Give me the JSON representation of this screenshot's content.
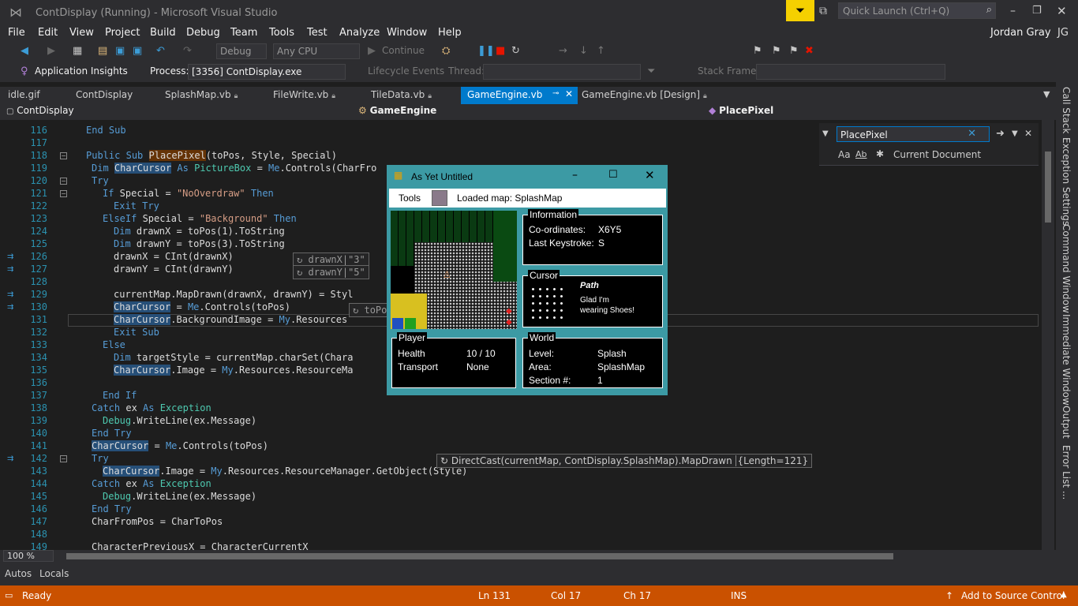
{
  "window": {
    "title": "ContDisplay (Running) - Microsoft Visual Studio",
    "quick_launch_placeholder": "Quick Launch (Ctrl+Q)",
    "user_name": "Jordan Gray",
    "user_initials": "JG"
  },
  "menu": [
    "File",
    "Edit",
    "View",
    "Project",
    "Build",
    "Debug",
    "Team",
    "Tools",
    "Test",
    "Analyze",
    "Window",
    "Help"
  ],
  "toolbar1": {
    "config": "Debug",
    "platform": "Any CPU",
    "continue_label": "Continue"
  },
  "toolbar2": {
    "app_insights": "Application Insights",
    "process_label": "Process:",
    "process_value": "[3356] ContDisplay.exe",
    "lifecycle_label": "Lifecycle Events",
    "thread_label": "Thread:",
    "stack_frame_label": "Stack Frame:"
  },
  "tabs": [
    {
      "label": "idle.gif"
    },
    {
      "label": "ContDisplay"
    },
    {
      "label": "SplashMap.vb"
    },
    {
      "label": "FileWrite.vb"
    },
    {
      "label": "TileData.vb"
    },
    {
      "label": "GameEngine.vb"
    },
    {
      "label": "GameEngine.vb [Design]"
    }
  ],
  "nav": {
    "project": "ContDisplay",
    "class": "GameEngine",
    "member": "PlacePixel"
  },
  "find": {
    "query": "PlacePixel",
    "scope": "Current Document",
    "opt_case": "Aa",
    "opt_word": "Ab"
  },
  "code_lines": [
    {
      "n": "116",
      "text": "End Sub"
    },
    {
      "n": "117",
      "text": ""
    },
    {
      "n": "118",
      "text": "Public Sub PlacePixel(toPos, Style, Special)"
    },
    {
      "n": "119",
      "text": "Dim CharCursor As PictureBox = Me.Controls(CharFro"
    },
    {
      "n": "120",
      "text": "Try"
    },
    {
      "n": "121",
      "text": "If Special = \"NoOverdraw\" Then"
    },
    {
      "n": "122",
      "text": "Exit Try"
    },
    {
      "n": "123",
      "text": "ElseIf Special = \"Background\" Then"
    },
    {
      "n": "124",
      "text": "Dim drawnX = toPos(1).ToString"
    },
    {
      "n": "125",
      "text": "Dim drawnY = toPos(3).ToString"
    },
    {
      "n": "126",
      "text": "drawnX = CInt(drawnX)"
    },
    {
      "n": "127",
      "text": "drawnY = CInt(drawnY)"
    },
    {
      "n": "128",
      "text": ""
    },
    {
      "n": "129",
      "text": "currentMap.MapDrawn(drawnX, drawnY) = Styl"
    },
    {
      "n": "130",
      "text": "CharCursor = Me.Controls(toPos)"
    },
    {
      "n": "131",
      "text": "CharCursor.BackgroundImage = My.Resources"
    },
    {
      "n": "132",
      "text": "Exit Sub"
    },
    {
      "n": "133",
      "text": "Else"
    },
    {
      "n": "134",
      "text": "Dim targetStyle = currentMap.charSet(Chara"
    },
    {
      "n": "135",
      "text": "CharCursor.Image = My.Resources.ResourceMa"
    },
    {
      "n": "136",
      "text": ""
    },
    {
      "n": "137",
      "text": "End If"
    },
    {
      "n": "138",
      "text": "Catch ex As Exception"
    },
    {
      "n": "139",
      "text": "Debug.WriteLine(ex.Message)"
    },
    {
      "n": "140",
      "text": "End Try"
    },
    {
      "n": "141",
      "text": "CharCursor = Me.Controls(toPos)"
    },
    {
      "n": "142",
      "text": "Try"
    },
    {
      "n": "143",
      "text": "CharCursor.Image = My.Resources.ResourceManager.GetObject(Style)"
    },
    {
      "n": "144",
      "text": "Catch ex As Exception"
    },
    {
      "n": "145",
      "text": "Debug.WriteLine(ex.Message)"
    },
    {
      "n": "146",
      "text": "End Try"
    },
    {
      "n": "147",
      "text": "CharFromPos = CharToPos"
    },
    {
      "n": "148",
      "text": ""
    },
    {
      "n": "149",
      "text": "CharacterPreviousX = CharacterCurrentX"
    }
  ],
  "datatips": {
    "drawnX_name": "drawnX",
    "drawnX_val": "\"3\"",
    "drawnY_name": "drawnY",
    "drawnY_val": "\"5\"",
    "topos": "toPos",
    "directcast": "DirectCast(currentMap, ContDisplay.SplashMap).MapDrawn",
    "length": "{Length=121}"
  },
  "form": {
    "title": "As Yet Untitled",
    "menu_tools": "Tools",
    "loaded_map": "Loaded map: SplashMap",
    "information": {
      "title": "Information",
      "coords_label": "Co-ordinates:",
      "coords_value": "X6Y5",
      "keystroke_label": "Last Keystroke:",
      "keystroke_value": "S"
    },
    "cursor": {
      "title": "Cursor",
      "name": "Path",
      "desc_line1": "Glad I'm",
      "desc_line2": "wearing Shoes!"
    },
    "player": {
      "title": "Player",
      "health_label": "Health",
      "health_value": "10 / 10",
      "transport_label": "Transport",
      "transport_value": "None"
    },
    "world": {
      "title": "World",
      "level_label": "Level:",
      "level_value": "Splash",
      "area_label": "Area:",
      "area_value": "SplashMap",
      "section_label": "Section #:",
      "section_value": "1"
    }
  },
  "zoom": "100 %",
  "bottom_tabs": [
    "Autos",
    "Locals"
  ],
  "right_tabs": [
    "Call Stack",
    "Exception Settings",
    "Command Window",
    "Immediate Window",
    "Output",
    "Error List ..."
  ],
  "status": {
    "ready": "Ready",
    "ln": "Ln 131",
    "col": "Col 17",
    "ch": "Ch 17",
    "mode": "INS",
    "source_control": "Add to Source Control"
  },
  "colors": {
    "accent": "#ca5100",
    "form_chrome": "#3c9aa4",
    "editor_bg": "#1e1e1e"
  }
}
